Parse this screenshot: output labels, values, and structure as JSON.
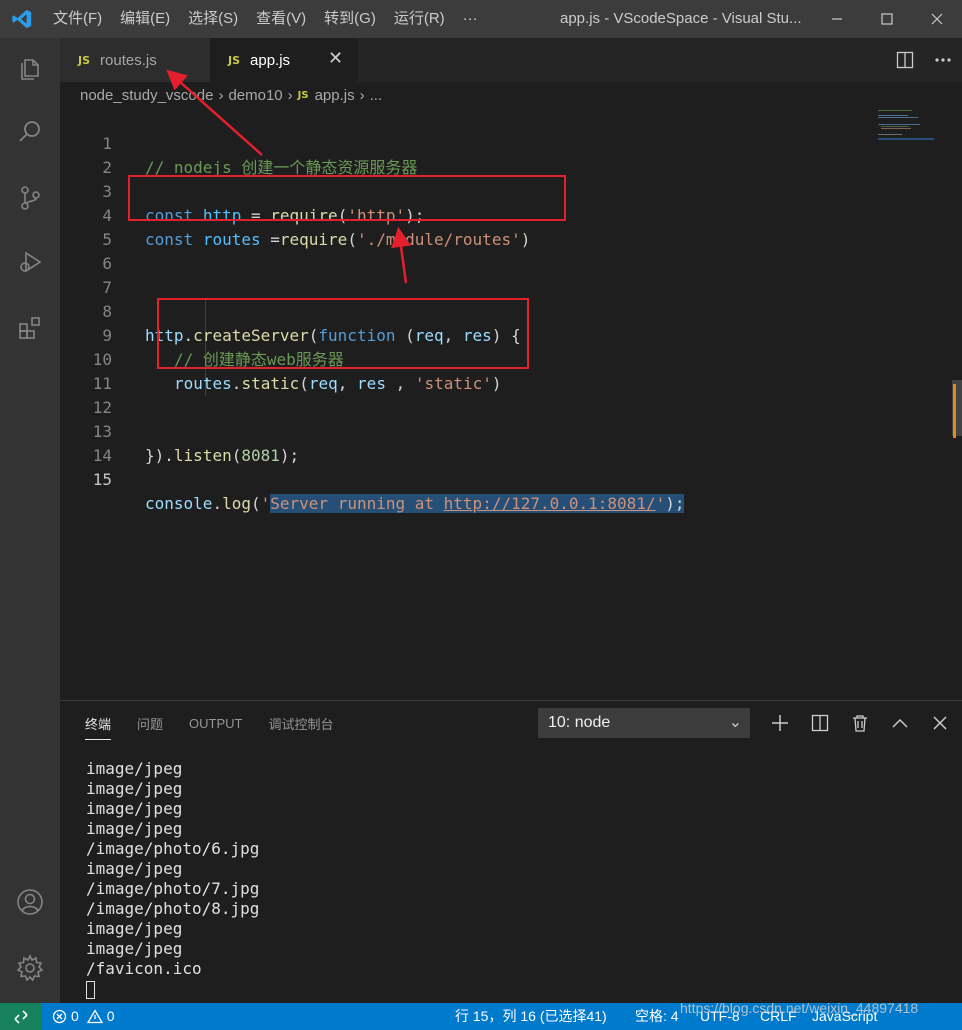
{
  "titlebar": {
    "menu": [
      "文件(F)",
      "编辑(E)",
      "选择(S)",
      "查看(V)",
      "转到(G)",
      "运行(R)",
      "···"
    ],
    "title": "app.js - VScodeSpace - Visual Stu...",
    "window_controls": [
      "minimize-icon",
      "maximize-icon",
      "close-icon"
    ]
  },
  "activitybar": {
    "icons": [
      "explorer-icon",
      "search-icon",
      "source-control-icon",
      "run-debug-icon",
      "extensions-icon",
      "account-icon",
      "settings-gear-icon"
    ]
  },
  "tabs": [
    {
      "icon": "JS",
      "label": "routes.js",
      "active": false
    },
    {
      "icon": "JS",
      "label": "app.js",
      "active": true,
      "close": "✕"
    }
  ],
  "tab_actions": [
    "split-editor-icon",
    "more-actions-icon"
  ],
  "breadcrumb": {
    "parts": [
      "node_study_vscode",
      "demo10"
    ],
    "file_icon": "JS",
    "file": "app.js",
    "tail": "..."
  },
  "editor": {
    "active_line": 15,
    "lines": [
      {
        "n": "1"
      },
      {
        "n": "2"
      },
      {
        "n": "3"
      },
      {
        "n": "4"
      },
      {
        "n": "5"
      },
      {
        "n": "6"
      },
      {
        "n": "7"
      },
      {
        "n": "8"
      },
      {
        "n": "9"
      },
      {
        "n": "10"
      },
      {
        "n": "11"
      },
      {
        "n": "12"
      },
      {
        "n": "13"
      },
      {
        "n": "14"
      },
      {
        "n": "15"
      }
    ],
    "code": {
      "l1": "// nodejs 创建一个静态资源服务器",
      "l3_kw": "const",
      "l3_var": "http",
      "l3_eq": " = ",
      "l3_fn": "require",
      "l3_str": "'http'",
      "l3_end": ");",
      "l4_kw": "const",
      "l4_var": "routes",
      "l4_eq": " =",
      "l4_fn": "require",
      "l4_str": "'./module/routes'",
      "l4_end": ")",
      "l8_obj": "http",
      "l8_fn": "createServer",
      "l8_kw": "function",
      "l8_p1": "req",
      "l8_p2": "res",
      "l9": "// 创建静态web服务器",
      "l10_obj": "routes",
      "l10_fn": "static",
      "l10_p1": "req",
      "l10_p2": "res",
      "l10_str": "'static'",
      "l13_fn": "listen",
      "l13_num": "8081",
      "l15_obj": "console",
      "l15_fn": "log",
      "l15_str_a": "'",
      "l15_str_sel": "Server running at ",
      "l15_url": "http://127.0.0.1:8081/",
      "l15_str_b": "'",
      "l15_end": ");"
    }
  },
  "panel": {
    "tabs": [
      "终端",
      "问题",
      "OUTPUT",
      "调试控制台"
    ],
    "active_tab": "终端",
    "terminal_select": "10: node",
    "actions": [
      "add-terminal-icon",
      "split-terminal-icon",
      "trash-icon",
      "maximize-panel-icon",
      "close-panel-icon"
    ],
    "terminal_lines": [
      "image/jpeg",
      "image/jpeg",
      "image/jpeg",
      "image/jpeg",
      "/image/photo/6.jpg",
      "image/jpeg",
      "/image/photo/7.jpg",
      "/image/photo/8.jpg",
      "image/jpeg",
      "image/jpeg",
      "/favicon.ico"
    ]
  },
  "statusbar": {
    "errors": "0",
    "warnings": "0",
    "position": "行 15，列 16 (已选择41)",
    "spaces": "空格: 4",
    "encoding": "UTF-8",
    "eol": "CRLF",
    "language": "JavaScript",
    "watermark": "https://blog.csdn.net/weixin_44897418"
  },
  "colors": {
    "statusbar": "#007acc",
    "annotation_red": "#e5202e",
    "selection": "#264f78"
  }
}
